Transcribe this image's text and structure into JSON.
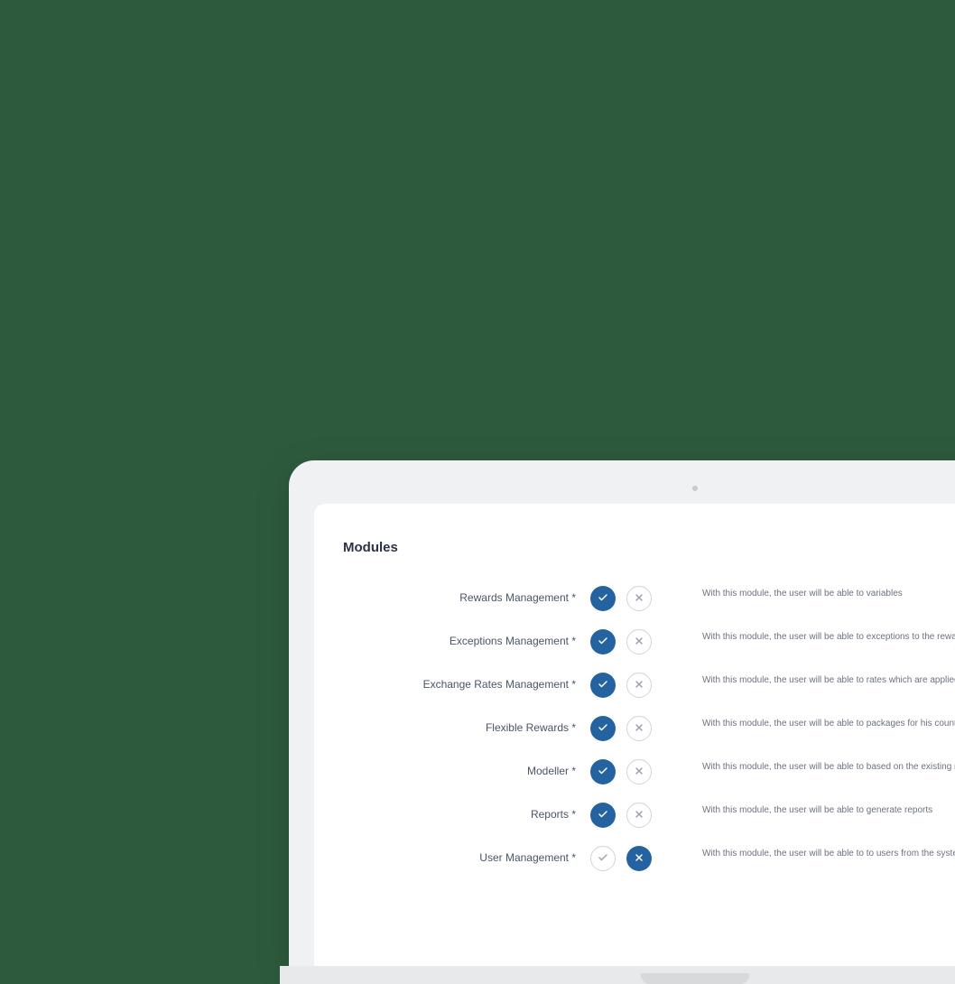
{
  "section_title": "Modules",
  "modules": [
    {
      "label": "Rewards Management *",
      "enabled": true,
      "desc": "With this module, the user will be able to variables"
    },
    {
      "label": "Exceptions Management *",
      "enabled": true,
      "desc": "With this module, the user will be able to exceptions to the rewards"
    },
    {
      "label": "Exchange Rates Management *",
      "enabled": true,
      "desc": "With this module, the user will be able to rates which are applied to rewards"
    },
    {
      "label": "Flexible Rewards *",
      "enabled": true,
      "desc": "With this module, the user will be able to packages for his countries"
    },
    {
      "label": "Modeller *",
      "enabled": true,
      "desc": "With this module, the user will be able to based on the existing rewards"
    },
    {
      "label": "Reports *",
      "enabled": true,
      "desc": "With this module, the user will be able to generate reports"
    },
    {
      "label": "User Management *",
      "enabled": false,
      "desc": "With this module, the user will be able to to users from the system"
    }
  ]
}
